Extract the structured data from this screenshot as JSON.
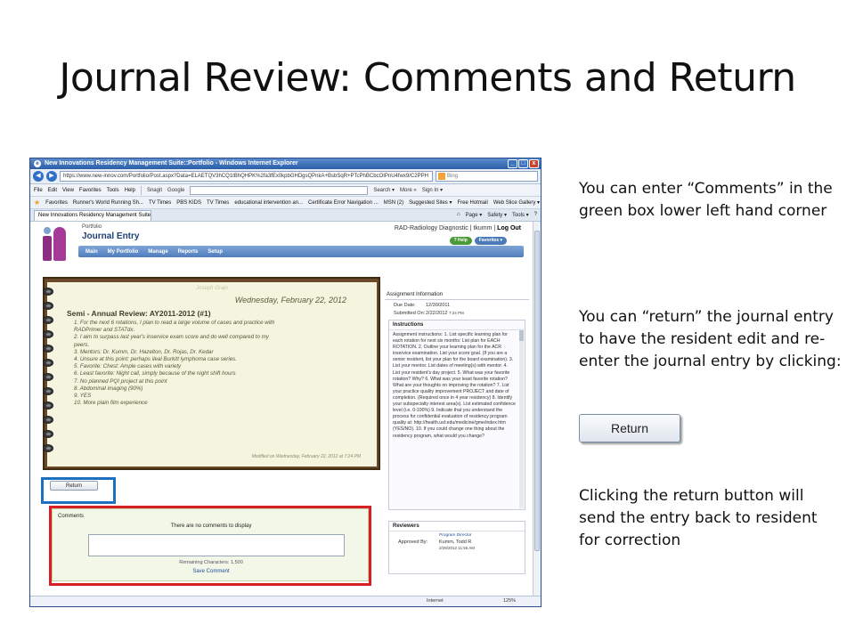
{
  "slide": {
    "title": "Journal Review: Comments and Return",
    "note_comments": "You can enter “Comments” in the green box lower left hand corner",
    "note_return": "You can “return” the journal entry to have the resident edit and re-enter the journal entry by clicking:",
    "return_button_label": "Return",
    "note_clicking": "Clicking the return button will send the entry back to resident for correction"
  },
  "browser": {
    "window_title": "New Innovations Residency Management Suite::Portfolio - Windows Internet Explorer",
    "url": "https://www.new-innov.com/Portfolio/Post.aspx?Data=ELAETQV3hCQ1tBhQHPK%2fa3fEx0kpbGHDgsQPnkA+BsbSqR+PTcPhBCbcOIPnU4fwx9/C2PPH",
    "search_placeholder": "Bing",
    "menu_items": [
      "File",
      "Edit",
      "View",
      "Favorites",
      "Tools",
      "Help"
    ],
    "toolbar_extras": [
      "Snagit",
      "Google",
      "Search ▾",
      "More »",
      "Sign In ▾"
    ],
    "favorites_label": "Favorites",
    "favorites_items": [
      "Runner's World Running Sh...",
      "TV Times",
      "PBS KIDS",
      "TV Times",
      "educational intervention an...",
      "Certificate Error Navigation ...",
      "MSN (2)",
      "Suggested Sites ▾",
      "Free Hotmail",
      "Web Slice Gallery ▾"
    ],
    "active_tab": "New Innovations Residency Management Suite::Portf...",
    "command_items": [
      "Page ▾",
      "Safety ▾",
      "Tools ▾"
    ],
    "status_zone": "Internet",
    "status_zoom": "125%"
  },
  "app": {
    "section_label": "Portfolio",
    "page_title": "Journal Entry",
    "user_line_prefix": "RAD-Radiology Diagnostic | tkumm |",
    "logout": "Log Out",
    "help_label": "? Help",
    "favorites_label": "Favorites ▾",
    "nav_items": [
      "Main",
      "My Portfolio",
      "Manage",
      "Reports",
      "Setup"
    ]
  },
  "journal": {
    "author": "Joseph Grajo",
    "date": "Wednesday, February 22, 2012",
    "heading": "Semi - Annual Review: AY2011-2012 (#1)",
    "items": [
      "1. For the next 6 rotations, I plan to read a large volume of cases and practice with",
      "RADPrimer and STATdx.",
      "2. I aim to surpass last year's inservice exam score and do well compared to my",
      "peers.",
      "3. Mentors: Dr. Kumm, Dr. Hazelton, Dr. Rojas, Dr. Kedar",
      "4. Unsure at this point: perhaps ileal Burkitt lymphoma case series.",
      "5. Favorite: Chest: Ample cases with variety",
      "6. Least favorite: Night call, simply because of the night shift hours",
      "7. No planned PQI project at this point",
      "8. Abdominal imaging (90%)",
      "9. YES",
      "10. More plain film experience"
    ],
    "modified": "Modified on Wednesday, February 22, 2012 at 7:24 PM",
    "return_label": "Return"
  },
  "comments": {
    "label": "Comments",
    "none_text": "There are no comments to display",
    "remaining": "Remaining Characters: 1,500",
    "save_label": "Save Comment"
  },
  "assignment": {
    "title": "Assignment Information",
    "due_label": "Due Date:",
    "due_value": "12/30/2011",
    "submitted_label": "Submitted On:",
    "submitted_date": "2/22/2012",
    "submitted_time": "7:24 PM",
    "instructions_title": "Instructions",
    "instructions_text": "Assignment instructions: 1. List specific learning plan for each rotation for next six months: List plan for EACH ROTATION. 2. Outline your learning plan for the ACR inservice examination. List your score goal. (If you are a senior resident, list your plan for the board examination). 3. List your mentor. List dates of meeting(s) with mentor. 4. List your resident's day project. 5. What was your favorite rotation? Why? 6. What was your least favorite rotation? What are your thoughts on improving the rotation? 7. List your practice quality improvement PROJECT and date of completion. (Required once in 4 year residency) 8. Identify your subspecialty interest area(s). List estimated confidence level (i.e. 0-100%) 9. Indicate that you understand the process for confidential evaluation of residency program quality at: http://health.usf.edu/medicine/gme/index.htm (YES/NO). 10. If you could change one thing about the residency program, what would you change?",
    "reviewers_title": "Reviewers",
    "reviewer_role": "Program Director",
    "approved_label": "Approved By:",
    "approved_value": "Kumm, Todd R",
    "approved_date": "2/28/2012 11:55 AM"
  }
}
